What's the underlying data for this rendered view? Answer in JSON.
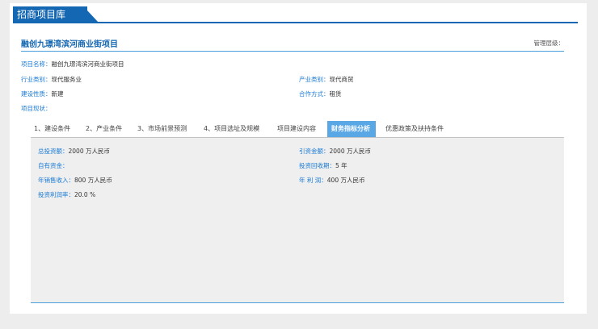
{
  "header": {
    "title": "招商项目库"
  },
  "project": {
    "title": "融创九璟湾滨河商业街项目",
    "manage_level_label": "管理层级："
  },
  "fields": {
    "name_label": "项目名称：",
    "name_value": "融创九璟湾滨河商业街项目",
    "industry_label": "行业类别：",
    "industry_value": "现代服务业",
    "product_label": "产业类别：",
    "product_value": "现代商贸",
    "nature_label": "建设性质：",
    "nature_value": "新建",
    "coop_label": "合作方式：",
    "coop_value": "租赁",
    "status_label": "项目现状："
  },
  "tabs": [
    {
      "label": "1、建设条件"
    },
    {
      "label": "2、产业条件"
    },
    {
      "label": "3、市场前景预测"
    },
    {
      "label": "4、项目选址及规模"
    },
    {
      "label": "项目建设内容"
    },
    {
      "label": "财务指标分析"
    },
    {
      "label": "优惠政策及扶持条件"
    }
  ],
  "active_tab": "财务指标分析",
  "finance": {
    "total_invest_label": "总投资额：",
    "total_invest_value": "2000 万人民币",
    "attract_label": "引资金额：",
    "attract_value": "2000 万人民币",
    "own_funds_label": "自有资金：",
    "payback_label": "投资回收期：",
    "payback_value": "5 年",
    "annual_sales_label": "年销售收入：",
    "annual_sales_value": "800 万人民币",
    "annual_profit_label": "年 利 润：",
    "annual_profit_value": "400 万人民币",
    "roi_label": "投资利润率：",
    "roi_value": "20.0 %"
  },
  "colors": {
    "brand": "#1467b3",
    "label_blue": "#1a7ad4",
    "active_tab": "#5aa7e6"
  }
}
